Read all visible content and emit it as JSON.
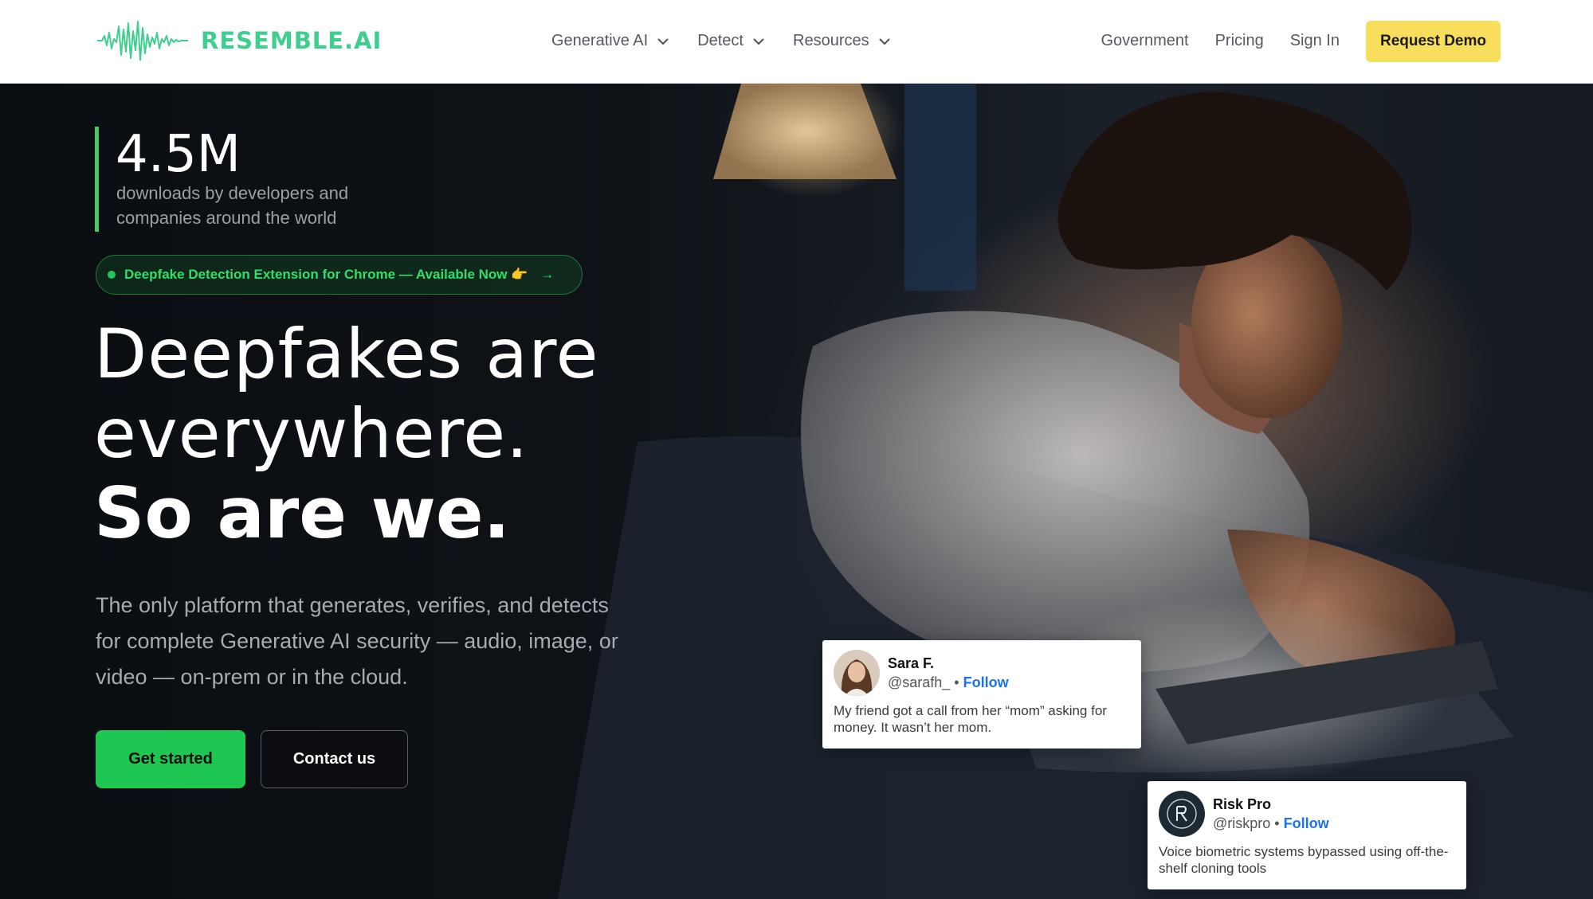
{
  "nav": {
    "logo_text": "RESEMBLE.AI",
    "menu": [
      {
        "label": "Generative AI"
      },
      {
        "label": "Detect"
      },
      {
        "label": "Resources"
      }
    ],
    "links": [
      "Government",
      "Pricing",
      "Sign In"
    ],
    "cta_label": "Request Demo"
  },
  "hero": {
    "stat_value": "4.5M",
    "stat_caption": "downloads by developers and companies around the world",
    "badge_text": "Deepfake Detection Extension for Chrome — Available Now 👉",
    "badge_arrow": "→",
    "headline_line1": "Deepfakes are",
    "headline_line2": "everywhere.",
    "headline_line3": "So are we.",
    "subheadline": "The only platform that generates, verifies, and detects for complete Generative AI security — audio, image, or video — on-prem or in the cloud.",
    "primary_button": "Get started",
    "secondary_button": "Contact us"
  },
  "testimonials": [
    {
      "name": "Sara F.",
      "handle": "@sarafh_ •",
      "follow": "Follow",
      "message": "My friend got a call from her “mom” asking for money. It wasn’t her mom."
    },
    {
      "name": "Risk Pro",
      "handle": "@riskpro •",
      "follow": "Follow",
      "message": "Voice biometric systems bypassed using off-the-shelf cloning tools"
    }
  ],
  "colors": {
    "brand_green": "#3ecf8e",
    "cta_yellow": "#f7de5d",
    "primary_green": "#1ec751",
    "follow_blue": "#1a73e8"
  }
}
